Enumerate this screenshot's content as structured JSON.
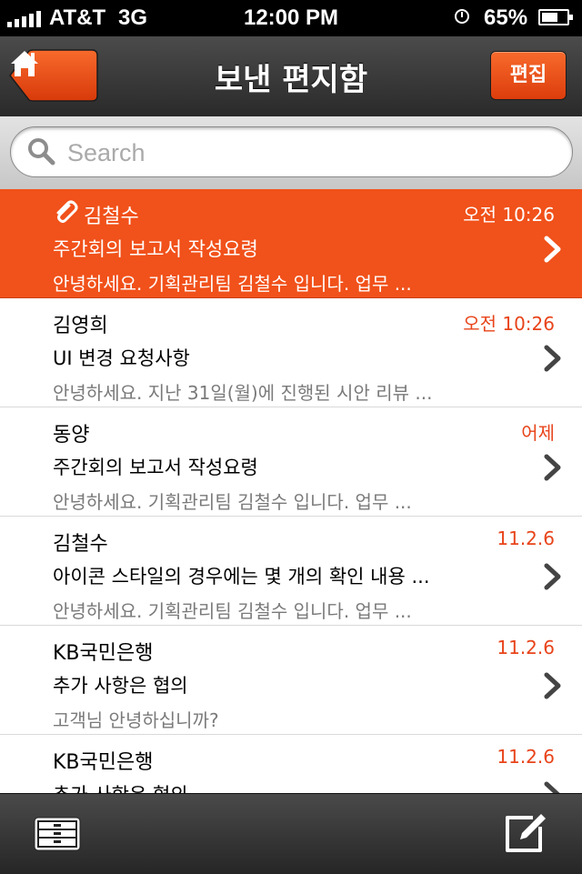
{
  "status_bar": {
    "carrier": "AT&T",
    "network": "3G",
    "time": "12:00 PM",
    "battery": "65%",
    "battery_level": 0.65,
    "icons": [
      "signal-bars-icon",
      "clock-icon",
      "battery-icon"
    ]
  },
  "nav": {
    "title": "보낸 편지함",
    "edit_label": "편집",
    "home_icon": "home-icon"
  },
  "search": {
    "placeholder": "Search"
  },
  "colors": {
    "accent": "#f1511a",
    "date": "#e8441a",
    "bar": "#333333"
  },
  "messages": [
    {
      "sender": "김철수",
      "date": "오전 10:26",
      "subject": "주간회의 보고서 작성요령",
      "preview": "안녕하세요. 기획관리팀 김철수 입니다. 업무 ...",
      "has_attachment": true,
      "selected": true
    },
    {
      "sender": "김영희",
      "date": "오전 10:26",
      "subject": "UI 변경 요청사항",
      "preview": "안녕하세요. 지난 31일(월)에 진행된 시안 리뷰 ..."
    },
    {
      "sender": "동양",
      "date": "어제",
      "subject": "주간회의 보고서 작성요령",
      "preview": "안녕하세요. 기획관리팀 김철수 입니다. 업무 ..."
    },
    {
      "sender": "김철수",
      "date": "11.2.6",
      "subject": "아이콘 스타일의 경우에는 몇 개의 확인 내용 ...",
      "preview": "안녕하세요. 기획관리팀 김철수 입니다. 업무 ..."
    },
    {
      "sender": "KB국민은행",
      "date": "11.2.6",
      "subject": "추가 사항은 협의",
      "preview": "고객님 안녕하십니까?"
    },
    {
      "sender": "KB국민은행",
      "date": "11.2.6",
      "subject": "추가 사항은 협의",
      "preview": ""
    }
  ],
  "toolbar": {
    "left_icon": "archive-icon",
    "right_icon": "compose-icon"
  }
}
